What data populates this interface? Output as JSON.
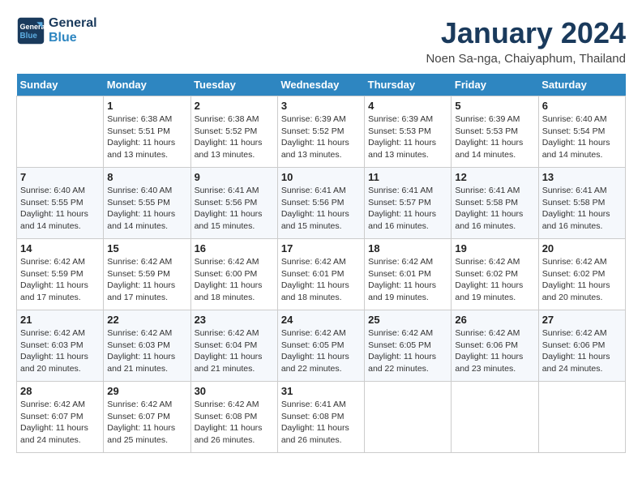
{
  "header": {
    "logo_line1": "General",
    "logo_line2": "Blue",
    "month_title": "January 2024",
    "location": "Noen Sa-nga, Chaiyaphum, Thailand"
  },
  "days_of_week": [
    "Sunday",
    "Monday",
    "Tuesday",
    "Wednesday",
    "Thursday",
    "Friday",
    "Saturday"
  ],
  "weeks": [
    [
      {
        "day": "",
        "info": ""
      },
      {
        "day": "1",
        "info": "Sunrise: 6:38 AM\nSunset: 5:51 PM\nDaylight: 11 hours and 13 minutes."
      },
      {
        "day": "2",
        "info": "Sunrise: 6:38 AM\nSunset: 5:52 PM\nDaylight: 11 hours and 13 minutes."
      },
      {
        "day": "3",
        "info": "Sunrise: 6:39 AM\nSunset: 5:52 PM\nDaylight: 11 hours and 13 minutes."
      },
      {
        "day": "4",
        "info": "Sunrise: 6:39 AM\nSunset: 5:53 PM\nDaylight: 11 hours and 13 minutes."
      },
      {
        "day": "5",
        "info": "Sunrise: 6:39 AM\nSunset: 5:53 PM\nDaylight: 11 hours and 14 minutes."
      },
      {
        "day": "6",
        "info": "Sunrise: 6:40 AM\nSunset: 5:54 PM\nDaylight: 11 hours and 14 minutes."
      }
    ],
    [
      {
        "day": "7",
        "info": "Sunrise: 6:40 AM\nSunset: 5:55 PM\nDaylight: 11 hours and 14 minutes."
      },
      {
        "day": "8",
        "info": "Sunrise: 6:40 AM\nSunset: 5:55 PM\nDaylight: 11 hours and 14 minutes."
      },
      {
        "day": "9",
        "info": "Sunrise: 6:41 AM\nSunset: 5:56 PM\nDaylight: 11 hours and 15 minutes."
      },
      {
        "day": "10",
        "info": "Sunrise: 6:41 AM\nSunset: 5:56 PM\nDaylight: 11 hours and 15 minutes."
      },
      {
        "day": "11",
        "info": "Sunrise: 6:41 AM\nSunset: 5:57 PM\nDaylight: 11 hours and 16 minutes."
      },
      {
        "day": "12",
        "info": "Sunrise: 6:41 AM\nSunset: 5:58 PM\nDaylight: 11 hours and 16 minutes."
      },
      {
        "day": "13",
        "info": "Sunrise: 6:41 AM\nSunset: 5:58 PM\nDaylight: 11 hours and 16 minutes."
      }
    ],
    [
      {
        "day": "14",
        "info": "Sunrise: 6:42 AM\nSunset: 5:59 PM\nDaylight: 11 hours and 17 minutes."
      },
      {
        "day": "15",
        "info": "Sunrise: 6:42 AM\nSunset: 5:59 PM\nDaylight: 11 hours and 17 minutes."
      },
      {
        "day": "16",
        "info": "Sunrise: 6:42 AM\nSunset: 6:00 PM\nDaylight: 11 hours and 18 minutes."
      },
      {
        "day": "17",
        "info": "Sunrise: 6:42 AM\nSunset: 6:01 PM\nDaylight: 11 hours and 18 minutes."
      },
      {
        "day": "18",
        "info": "Sunrise: 6:42 AM\nSunset: 6:01 PM\nDaylight: 11 hours and 19 minutes."
      },
      {
        "day": "19",
        "info": "Sunrise: 6:42 AM\nSunset: 6:02 PM\nDaylight: 11 hours and 19 minutes."
      },
      {
        "day": "20",
        "info": "Sunrise: 6:42 AM\nSunset: 6:02 PM\nDaylight: 11 hours and 20 minutes."
      }
    ],
    [
      {
        "day": "21",
        "info": "Sunrise: 6:42 AM\nSunset: 6:03 PM\nDaylight: 11 hours and 20 minutes."
      },
      {
        "day": "22",
        "info": "Sunrise: 6:42 AM\nSunset: 6:03 PM\nDaylight: 11 hours and 21 minutes."
      },
      {
        "day": "23",
        "info": "Sunrise: 6:42 AM\nSunset: 6:04 PM\nDaylight: 11 hours and 21 minutes."
      },
      {
        "day": "24",
        "info": "Sunrise: 6:42 AM\nSunset: 6:05 PM\nDaylight: 11 hours and 22 minutes."
      },
      {
        "day": "25",
        "info": "Sunrise: 6:42 AM\nSunset: 6:05 PM\nDaylight: 11 hours and 22 minutes."
      },
      {
        "day": "26",
        "info": "Sunrise: 6:42 AM\nSunset: 6:06 PM\nDaylight: 11 hours and 23 minutes."
      },
      {
        "day": "27",
        "info": "Sunrise: 6:42 AM\nSunset: 6:06 PM\nDaylight: 11 hours and 24 minutes."
      }
    ],
    [
      {
        "day": "28",
        "info": "Sunrise: 6:42 AM\nSunset: 6:07 PM\nDaylight: 11 hours and 24 minutes."
      },
      {
        "day": "29",
        "info": "Sunrise: 6:42 AM\nSunset: 6:07 PM\nDaylight: 11 hours and 25 minutes."
      },
      {
        "day": "30",
        "info": "Sunrise: 6:42 AM\nSunset: 6:08 PM\nDaylight: 11 hours and 26 minutes."
      },
      {
        "day": "31",
        "info": "Sunrise: 6:41 AM\nSunset: 6:08 PM\nDaylight: 11 hours and 26 minutes."
      },
      {
        "day": "",
        "info": ""
      },
      {
        "day": "",
        "info": ""
      },
      {
        "day": "",
        "info": ""
      }
    ]
  ]
}
